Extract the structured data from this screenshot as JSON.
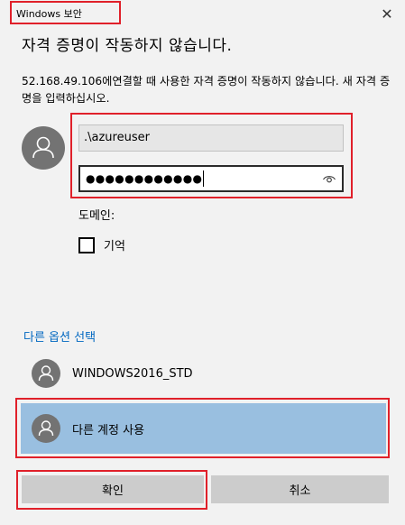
{
  "window": {
    "title": "Windows 보안",
    "close_glyph": "✕"
  },
  "dialog": {
    "heading": "자격 증명이 작동하지 않습니다.",
    "description": "52.168.49.106에연결할 때 사용한 자격 증명이 작동하지 않습니다. 새 자격 증명을 입력하십시오."
  },
  "credentials": {
    "username_value": ".\\azureuser",
    "password_masked": "●●●●●●●●●●●●"
  },
  "domain": {
    "label": "도메인:"
  },
  "remember": {
    "label": "기억",
    "checked": false
  },
  "more_options": {
    "link_text": "다른 옵션 선택",
    "accounts": [
      {
        "label": "WINDOWS2016_STD"
      },
      {
        "label": "다른 계정 사용",
        "selected": true
      }
    ]
  },
  "buttons": {
    "ok": "확인",
    "cancel": "취소"
  },
  "colors": {
    "link": "#0067c0",
    "selected_row": "#99bfe0",
    "avatar": "#737373",
    "highlight_box": "#e0202a",
    "button": "#cccccc"
  }
}
